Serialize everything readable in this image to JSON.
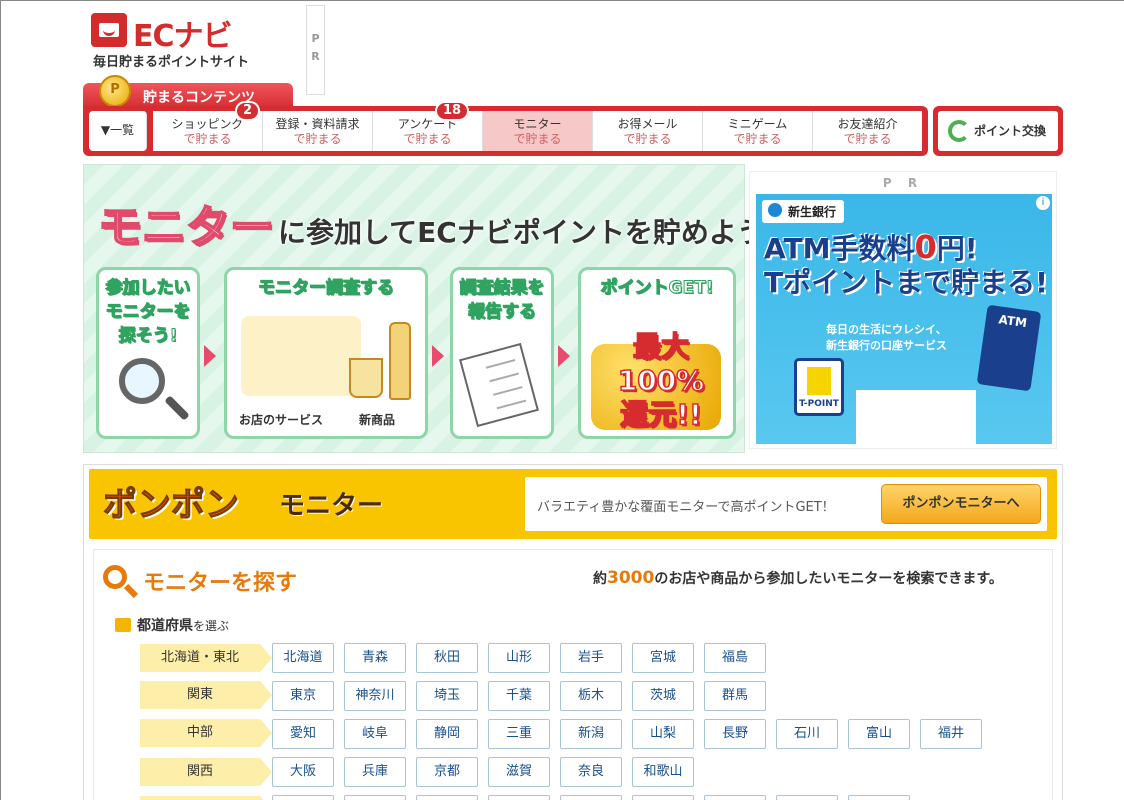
{
  "header": {
    "brand": "ECナビ",
    "tagline": "毎日貯まるポイントサイト",
    "pr_label": "P R"
  },
  "nav": {
    "title": "貯まるコンテンツ",
    "coin": "P",
    "list_label": "▼一覧",
    "items": [
      {
        "label": "ショッピング",
        "sub": "で貯まる",
        "badge": "2"
      },
      {
        "label": "登録・資料請求",
        "sub": "で貯まる",
        "badge": ""
      },
      {
        "label": "アンケート",
        "sub": "で貯まる",
        "badge": "18"
      },
      {
        "label": "モニター",
        "sub": "で貯まる",
        "badge": ""
      },
      {
        "label": "お得メール",
        "sub": "で貯まる",
        "badge": ""
      },
      {
        "label": "ミニゲーム",
        "sub": "で貯まる",
        "badge": ""
      },
      {
        "label": "お友達紹介",
        "sub": "で貯まる",
        "badge": ""
      }
    ],
    "exchange_label": "ポイント交換"
  },
  "hero": {
    "headline_big": "モニター",
    "headline_rest": "に参加してECナビポイントを貯めよう",
    "steps": [
      {
        "label": "参加したい\nモニターを\n探そう!"
      },
      {
        "label": "モニター調査する",
        "captions": [
          "お店のサービス",
          "新商品"
        ]
      },
      {
        "label": "調査結果を\n報告する"
      },
      {
        "label": "ポイントGET!",
        "big": "最大100%\n還元!!"
      }
    ]
  },
  "ad": {
    "pr_label": "P R",
    "bank": "新生銀行",
    "headline_1a": "ATM手数料",
    "headline_1b": "0",
    "headline_1c": "円!",
    "headline_2": "Tポイントまで貯まる!",
    "sub": "毎日の生活にウレシイ、\n新生銀行の口座サービス",
    "tpoint": "T-POINT",
    "atm": "ATM"
  },
  "ponpon": {
    "logo_a": "ポンポン",
    "logo_b": "モニター",
    "desc": "バラエティ豊かな覆面モニターで高ポイントGET！",
    "button": "ポンポンモニターへ"
  },
  "search": {
    "title": "モニターを探す",
    "note_pre": "約",
    "note_num": "3000",
    "note_post": "のお店や商品から参加したいモニターを検索できます。",
    "pref_title": "都道府県",
    "pref_title_small": "を選ぶ",
    "regions": [
      {
        "name": "北海道・東北",
        "prefs": [
          "北海道",
          "青森",
          "秋田",
          "山形",
          "岩手",
          "宮城",
          "福島"
        ]
      },
      {
        "name": "関東",
        "prefs": [
          "東京",
          "神奈川",
          "埼玉",
          "千葉",
          "栃木",
          "茨城",
          "群馬"
        ]
      },
      {
        "name": "中部",
        "prefs": [
          "愛知",
          "岐阜",
          "静岡",
          "三重",
          "新潟",
          "山梨",
          "長野",
          "石川",
          "富山",
          "福井"
        ]
      },
      {
        "name": "関西",
        "prefs": [
          "大阪",
          "兵庫",
          "京都",
          "滋賀",
          "奈良",
          "和歌山"
        ]
      }
    ]
  },
  "colors": {
    "brand_red": "#d62c30",
    "accent_orange": "#e87a0c",
    "banner_yellow": "#f9c400"
  }
}
